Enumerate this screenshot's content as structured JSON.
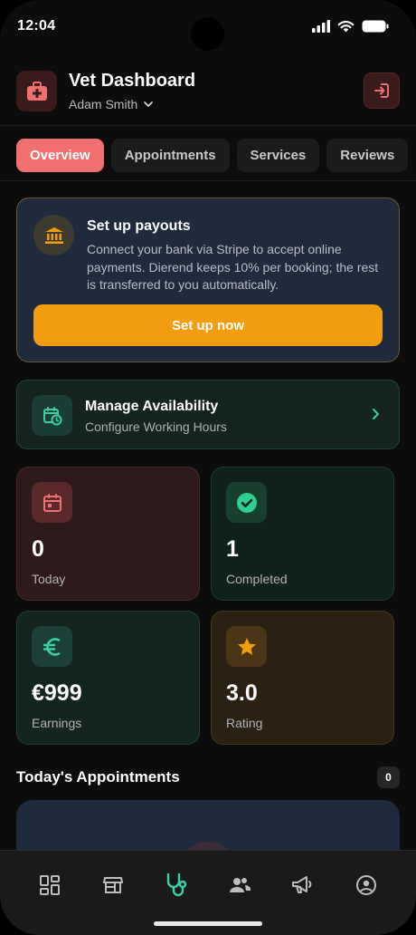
{
  "status_bar": {
    "time": "12:04"
  },
  "header": {
    "title": "Vet Dashboard",
    "user_name": "Adam Smith"
  },
  "tabs": [
    {
      "label": "Overview",
      "active": true
    },
    {
      "label": "Appointments",
      "active": false
    },
    {
      "label": "Services",
      "active": false
    },
    {
      "label": "Reviews",
      "active": false
    }
  ],
  "payouts": {
    "title": "Set up payouts",
    "description": "Connect your bank via Stripe to accept online payments. Dierend keeps 10% per booking; the rest is transferred to you automatically.",
    "button": "Set up now"
  },
  "availability": {
    "title": "Manage Availability",
    "subtitle": "Configure Working Hours"
  },
  "stats": {
    "today": {
      "value": "0",
      "label": "Today"
    },
    "completed": {
      "value": "1",
      "label": "Completed"
    },
    "earnings": {
      "value": "€999",
      "label": "Earnings"
    },
    "rating": {
      "value": "3.0",
      "label": "Rating"
    }
  },
  "appointments": {
    "title": "Today's Appointments",
    "count": "0"
  },
  "colors": {
    "accent_red": "#f07070",
    "cta_orange": "#f29d0f",
    "nav_active": "#3ad1a6"
  },
  "bottom_nav": [
    "dashboard-icon",
    "store-icon",
    "stethoscope-icon",
    "users-icon",
    "megaphone-icon",
    "account-icon"
  ]
}
